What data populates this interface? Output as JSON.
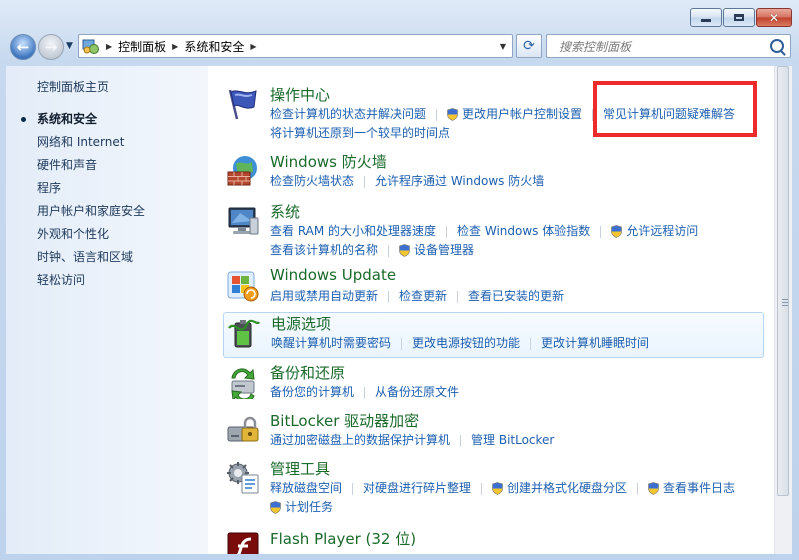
{
  "window": {
    "min_label": "minimize",
    "max_label": "maximize",
    "close_label": "close"
  },
  "address": {
    "crumbs": [
      "控制面板",
      "系统和安全"
    ]
  },
  "search": {
    "placeholder": "搜索控制面板"
  },
  "left_nav": {
    "home": "控制面板主页",
    "items": [
      {
        "label": "系统和安全",
        "current": true
      },
      {
        "label": "网络和 Internet"
      },
      {
        "label": "硬件和声音"
      },
      {
        "label": "程序"
      },
      {
        "label": "用户帐户和家庭安全"
      },
      {
        "label": "外观和个性化"
      },
      {
        "label": "时钟、语言和区域"
      },
      {
        "label": "轻松访问"
      }
    ]
  },
  "categories": [
    {
      "title": "操作中心",
      "icon": "flag-icon",
      "rows": [
        [
          "检查计算机的状态并解决问题",
          "更改用户帐户控制设置",
          "常见计算机问题疑难解答"
        ],
        [
          "将计算机还原到一个较早的时间点"
        ]
      ]
    },
    {
      "title": "Windows 防火墙",
      "icon": "firewall-icon",
      "rows": [
        [
          "检查防火墙状态",
          "允许程序通过 Windows 防火墙"
        ]
      ]
    },
    {
      "title": "系统",
      "icon": "computer-icon",
      "rows": [
        [
          "查看 RAM 的大小和处理器速度",
          "检查 Windows 体验指数",
          "允许远程访问"
        ],
        [
          "查看该计算机的名称",
          "设备管理器"
        ]
      ]
    },
    {
      "title": "Windows Update",
      "icon": "windows-update-icon",
      "rows": [
        [
          "启用或禁用自动更新",
          "检查更新",
          "查看已安装的更新"
        ]
      ]
    },
    {
      "title": "电源选项",
      "icon": "battery-icon",
      "rows": [
        [
          "唤醒计算机时需要密码",
          "更改电源按钮的功能",
          "更改计算机睡眠时间"
        ]
      ]
    },
    {
      "title": "备份和还原",
      "icon": "backup-icon",
      "rows": [
        [
          "备份您的计算机",
          "从备份还原文件"
        ]
      ]
    },
    {
      "title": "BitLocker 驱动器加密",
      "icon": "bitlocker-icon",
      "rows": [
        [
          "通过加密磁盘上的数据保护计算机",
          "管理 BitLocker"
        ]
      ]
    },
    {
      "title": "管理工具",
      "icon": "admin-tools-icon",
      "rows": [
        [
          "释放磁盘空间",
          "对硬盘进行碎片整理",
          "创建并格式化硬盘分区",
          "查看事件日志"
        ],
        [
          "计划任务"
        ]
      ]
    },
    {
      "title": "Flash Player (32 位)",
      "icon": "flash-icon",
      "rows": []
    }
  ],
  "colors": {
    "title_green": "#1a6a2a",
    "link_blue": "#1d5fb0",
    "highlight_red": "#ee2b2b"
  }
}
